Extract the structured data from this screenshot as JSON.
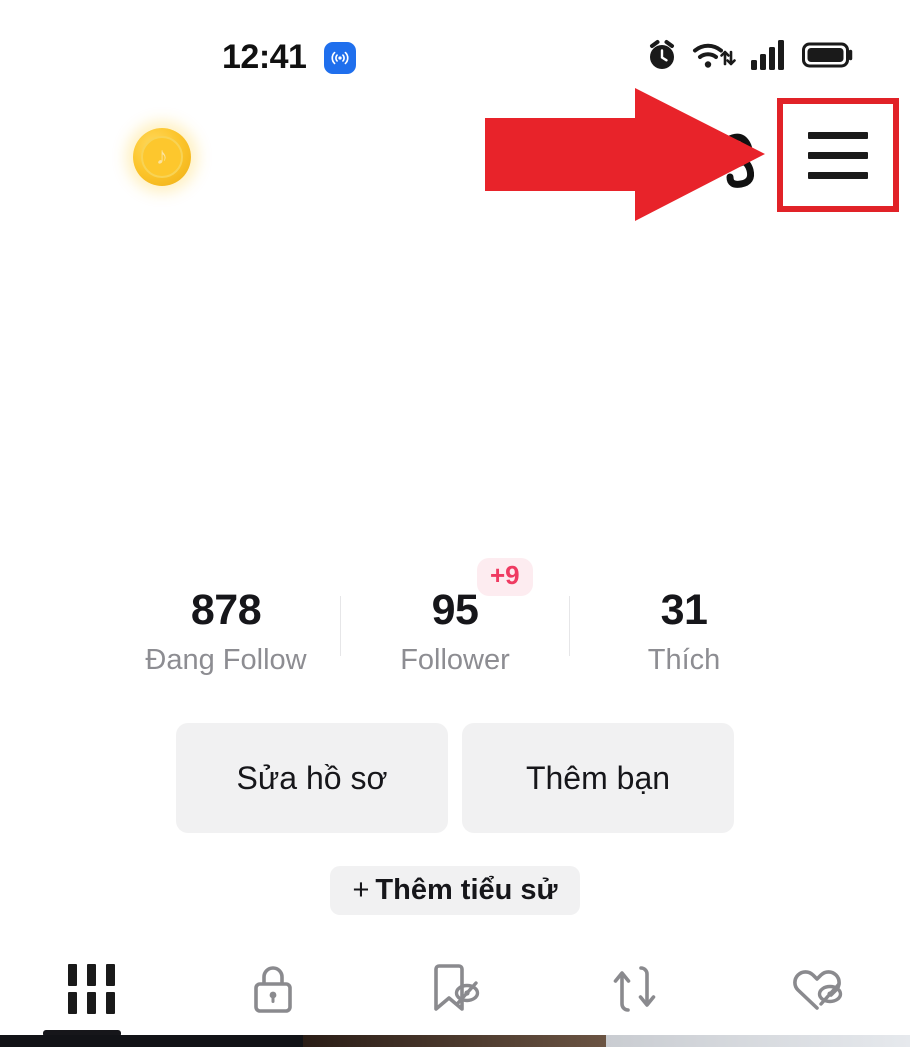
{
  "statusbar": {
    "time": "12:41",
    "live_icon": "broadcast-icon",
    "alarm_icon": "alarm-clock-icon",
    "wifi_icon": "wifi-icon",
    "signal_icon": "cellular-signal-icon",
    "battery_icon": "battery-full-icon"
  },
  "header": {
    "coin_icon": "tiktok-coin-icon",
    "obscured_icon": "partially-hidden-icon",
    "menu_icon": "hamburger-menu-icon",
    "highlight_color": "#e12228",
    "arrow_color": "#e8232a"
  },
  "stats": [
    {
      "value": "878",
      "label": "Đang Follow",
      "badge": null
    },
    {
      "value": "95",
      "label": "Follower",
      "badge": "+9"
    },
    {
      "value": "31",
      "label": "Thích",
      "badge": null
    }
  ],
  "actions": {
    "edit_profile": "Sửa hồ sơ",
    "add_friend": "Thêm bạn",
    "add_bio_plus": "+",
    "add_bio": "Thêm tiểu sử"
  },
  "tabs": [
    {
      "name": "posts-tab",
      "icon": "grid-icon",
      "active": true
    },
    {
      "name": "private-tab",
      "icon": "lock-icon",
      "active": false
    },
    {
      "name": "saved-tab",
      "icon": "bookmark-hidden-icon",
      "active": false
    },
    {
      "name": "reposts-tab",
      "icon": "repost-icon",
      "active": false
    },
    {
      "name": "liked-tab",
      "icon": "heart-hidden-icon",
      "active": false
    }
  ],
  "colors": {
    "badge_bg": "#fdecf0",
    "badge_text": "#ef3b62",
    "button_bg": "#f1f1f2",
    "muted_text": "#8d8d92",
    "primary_text": "#16161a",
    "tab_inactive": "#8a8a8e"
  },
  "thumbnails": [
    "#121317",
    "#0d0d10",
    "#4a3428",
    "#6b5443",
    "#c9ccd1",
    "#dfe2e6"
  ]
}
